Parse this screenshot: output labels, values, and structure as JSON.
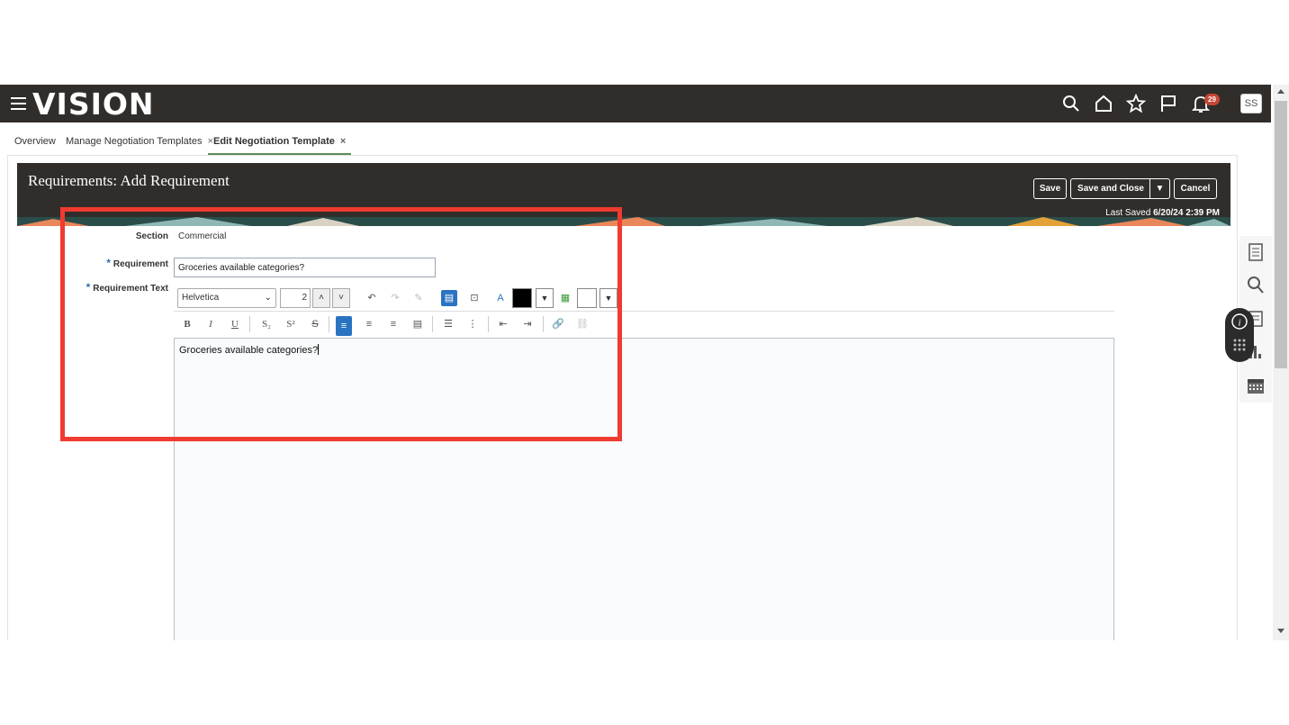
{
  "app": {
    "logo": "VISION",
    "notification_count": "29",
    "user_initials": "SS"
  },
  "tabs": [
    {
      "label": "Overview"
    },
    {
      "label": "Manage Negotiation Templates",
      "close": "×"
    },
    {
      "label": "Edit Negotiation Template",
      "close": "×",
      "active": true
    }
  ],
  "header": {
    "title": "Requirements: Add Requirement",
    "save_label": "Save",
    "save_close_label": "Save and Close",
    "cancel_label": "Cancel",
    "last_saved_label": "Last Saved",
    "last_saved_value": "6/20/24 2:39 PM"
  },
  "form": {
    "section_label": "Section",
    "section_value": "Commercial",
    "requirement_label": "Requirement",
    "requirement_value": "Groceries available categories?",
    "requirement_text_label": "Requirement Text",
    "required_marker": "*"
  },
  "editor": {
    "font": "Helvetica",
    "font_size": "2",
    "content": "Groceries available categories?",
    "text_color": "#000000",
    "background_color": "#ffffff"
  },
  "icons": {
    "menu": "hamburger-icon",
    "search": "search-icon",
    "home": "home-icon",
    "favorites": "star-icon",
    "flag": "flag-icon",
    "notifications": "bell-icon"
  },
  "colors": {
    "brand_bar": "#312d2a",
    "highlight": "#ef3b30",
    "accent": "#2a73c2"
  }
}
